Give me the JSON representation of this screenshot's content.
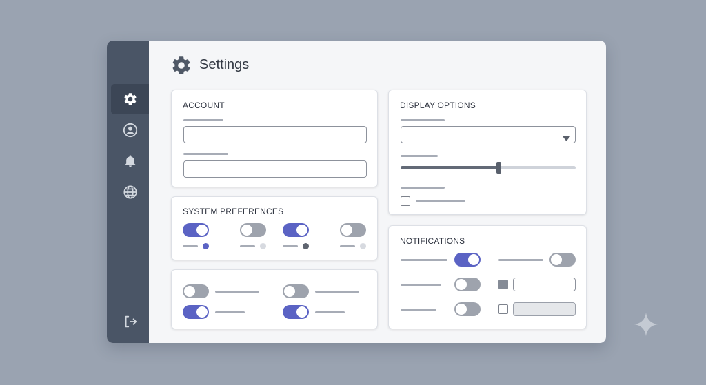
{
  "window": {
    "title": "Settings"
  },
  "sidebar": {
    "items": [
      {
        "id": "settings",
        "icon": "gear-icon",
        "active": true
      },
      {
        "id": "profile",
        "icon": "user-icon",
        "active": false
      },
      {
        "id": "notifications",
        "icon": "bell-icon",
        "active": false
      },
      {
        "id": "language",
        "icon": "globe-icon",
        "active": false
      }
    ],
    "bottom": {
      "id": "logout",
      "icon": "logout-icon"
    }
  },
  "account": {
    "title": "ACCOUNT",
    "field1_value": "",
    "field2_value": ""
  },
  "system_preferences": {
    "title": "SYSTEM PREFERENCES",
    "toggles": [
      true,
      false,
      true,
      false
    ]
  },
  "extra_toggles": {
    "toggles": [
      false,
      false,
      true,
      true
    ]
  },
  "display_options": {
    "title": "DISPLAY OPTIONS",
    "dropdown_value": "",
    "slider_value": 0.56,
    "checkbox_checked": false
  },
  "notifications": {
    "title": "NOTIFICATIONS",
    "toggles": [
      true,
      false,
      false,
      false
    ],
    "checkboxes": [
      true,
      false
    ],
    "input_value": ""
  },
  "colors": {
    "accent": "#5b63c4",
    "sidebar": "#4a5566",
    "toggle_off": "#9ea3ad"
  }
}
